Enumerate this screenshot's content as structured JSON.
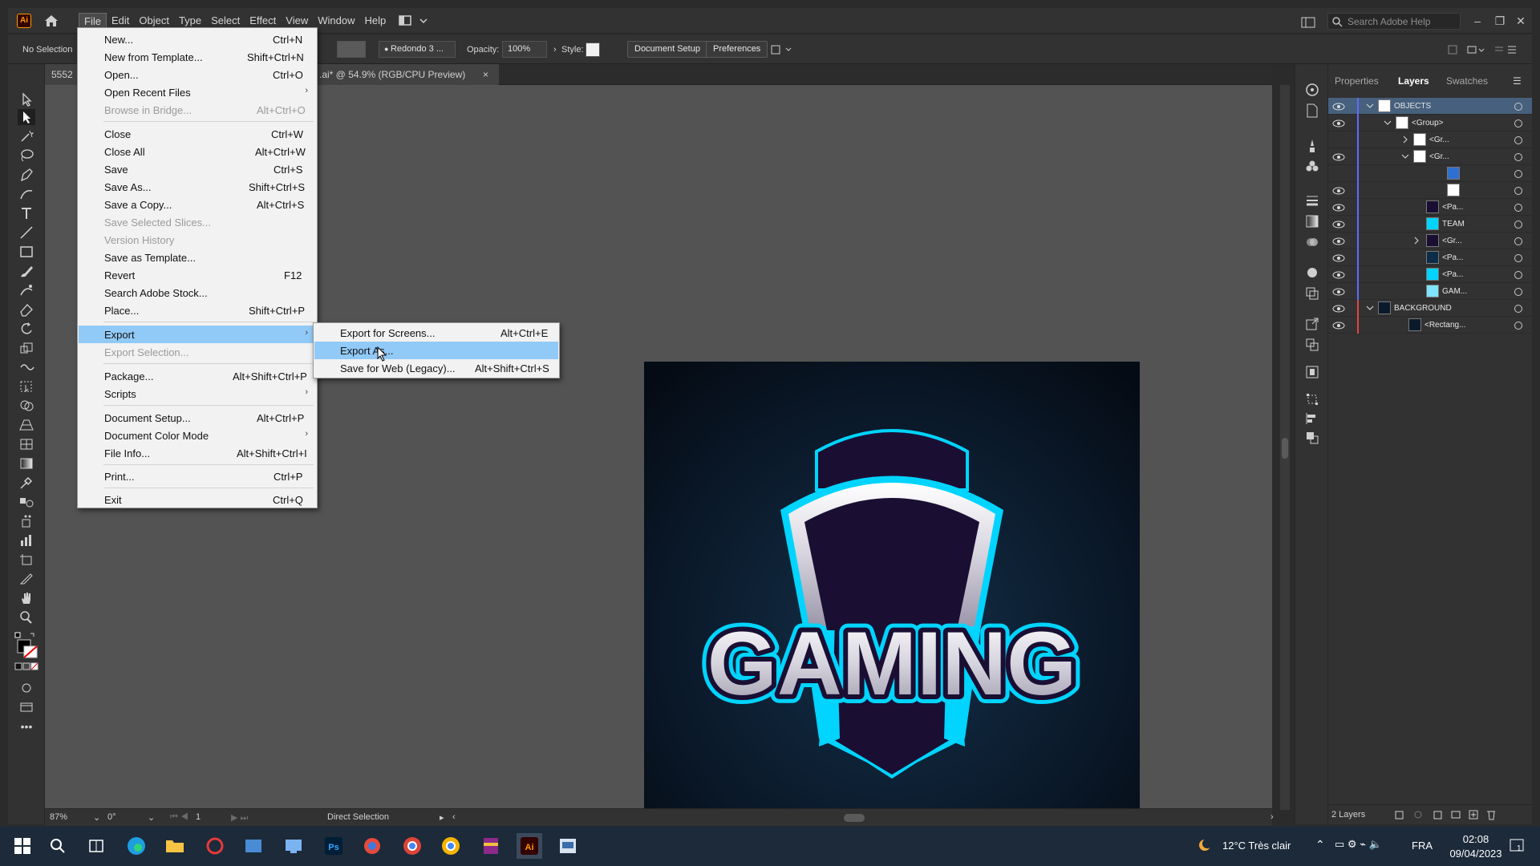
{
  "colors": {
    "accent": "#ff9a00",
    "highlight": "#91c9f7",
    "selection_row": "#46607d",
    "cyan": "#00d4ff",
    "navy": "#1a0f33"
  },
  "titlebar": {
    "app_icon_label": "Ai",
    "menu": [
      "File",
      "Edit",
      "Object",
      "Type",
      "Select",
      "Effect",
      "View",
      "Window",
      "Help"
    ],
    "help_search_placeholder": "Search Adobe Help"
  },
  "controlbar": {
    "selection_label": "No Selection",
    "brush_label": "Redondo 3 ...",
    "opacity_label": "Opacity:",
    "opacity_value": "100%",
    "style_label": "Style:",
    "document_setup": "Document Setup",
    "preferences": "Preferences"
  },
  "document": {
    "tab_prefix": "5552",
    "tab_title": ".ai* @ 54.9% (RGB/CPU Preview)",
    "tab_close": "×"
  },
  "artwork": {
    "word": "GAMING"
  },
  "statusbar": {
    "zoom": "87%",
    "rotation": "0°",
    "artboard_number": "1",
    "tool_name": "Direct Selection"
  },
  "file_menu": [
    {
      "label": "New...",
      "shortcut": "Ctrl+N"
    },
    {
      "label": "New from Template...",
      "shortcut": "Shift+Ctrl+N"
    },
    {
      "label": "Open...",
      "shortcut": "Ctrl+O"
    },
    {
      "label": "Open Recent Files",
      "shortcut": ""
    },
    {
      "label": "Browse in Bridge...",
      "shortcut": "Alt+Ctrl+O"
    },
    {
      "label": "Close",
      "shortcut": "Ctrl+W"
    },
    {
      "label": "Close All",
      "shortcut": "Alt+Ctrl+W"
    },
    {
      "label": "Save",
      "shortcut": "Ctrl+S"
    },
    {
      "label": "Save As...",
      "shortcut": "Shift+Ctrl+S"
    },
    {
      "label": "Save a Copy...",
      "shortcut": "Alt+Ctrl+S"
    },
    {
      "label": "Save Selected Slices...",
      "shortcut": ""
    },
    {
      "label": "Version History",
      "shortcut": ""
    },
    {
      "label": "Save as Template...",
      "shortcut": ""
    },
    {
      "label": "Revert",
      "shortcut": "F12"
    },
    {
      "label": "Search Adobe Stock...",
      "shortcut": ""
    },
    {
      "label": "Place...",
      "shortcut": "Shift+Ctrl+P"
    },
    {
      "label": "Export",
      "shortcut": ""
    },
    {
      "label": "Export Selection...",
      "shortcut": ""
    },
    {
      "label": "Package...",
      "shortcut": "Alt+Shift+Ctrl+P"
    },
    {
      "label": "Scripts",
      "shortcut": ""
    },
    {
      "label": "Document Setup...",
      "shortcut": "Alt+Ctrl+P"
    },
    {
      "label": "Document Color Mode",
      "shortcut": ""
    },
    {
      "label": "File Info...",
      "shortcut": "Alt+Shift+Ctrl+I"
    },
    {
      "label": "Print...",
      "shortcut": "Ctrl+P"
    },
    {
      "label": "Exit",
      "shortcut": "Ctrl+Q"
    }
  ],
  "export_submenu": [
    {
      "label": "Export for Screens...",
      "shortcut": "Alt+Ctrl+E"
    },
    {
      "label": "Export As...",
      "shortcut": ""
    },
    {
      "label": "Save for Web (Legacy)...",
      "shortcut": "Alt+Shift+Ctrl+S"
    }
  ],
  "panels": {
    "tabs": [
      "Properties",
      "Layers",
      "Swatches"
    ],
    "footer_label": "2 Layers"
  },
  "layers": [
    {
      "name": "OBJECTS"
    },
    {
      "name": "<Group>"
    },
    {
      "name": "<Gr..."
    },
    {
      "name": "<Gr..."
    },
    {
      "name": ""
    },
    {
      "name": ""
    },
    {
      "name": "<Pa..."
    },
    {
      "name": "TEAM"
    },
    {
      "name": "<Gr..."
    },
    {
      "name": "<Pa..."
    },
    {
      "name": "<Pa..."
    },
    {
      "name": "GAM..."
    },
    {
      "name": "BACKGROUND"
    },
    {
      "name": "<Rectang..."
    }
  ],
  "taskbar": {
    "weather": "12°C  Très clair",
    "language": "FRA",
    "time": "02:08",
    "date": "09/04/2023",
    "notification_count": "1"
  }
}
